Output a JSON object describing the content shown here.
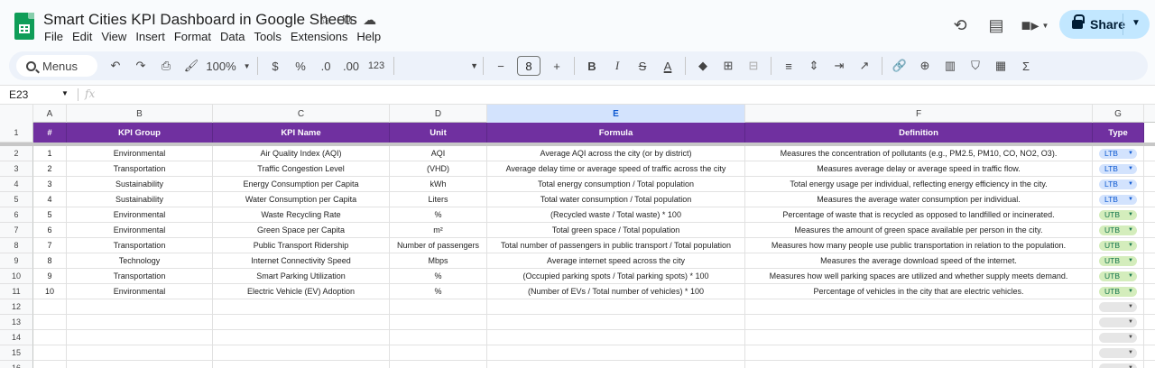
{
  "doc": {
    "title": "Smart Cities KPI Dashboard in Google Sheets"
  },
  "menu": [
    "File",
    "Edit",
    "View",
    "Insert",
    "Format",
    "Data",
    "Tools",
    "Extensions",
    "Help"
  ],
  "header": {
    "share_label": "Share"
  },
  "toolbar": {
    "menus_label": "Menus",
    "zoom": "100%",
    "currency": "$",
    "percent": "%",
    "dec_dec": ".0",
    "dec_inc": ".00",
    "number_format": "123",
    "font_size": "8"
  },
  "formula_bar": {
    "name_box": "E23",
    "fx": "fx"
  },
  "columns": [
    "A",
    "B",
    "C",
    "D",
    "E",
    "F",
    "G"
  ],
  "header_row": {
    "row_num": "1",
    "cells": [
      "#",
      "KPI Group",
      "KPI Name",
      "Unit",
      "Formula",
      "Definition",
      "Type"
    ]
  },
  "rows": [
    {
      "row_num": "2",
      "cells": [
        "1",
        "Environmental",
        "Air Quality Index (AQI)",
        "AQI",
        "Average AQI across the city (or by district)",
        "Measures the concentration of pollutants (e.g., PM2.5, PM10, CO, NO2, O3)."
      ],
      "type": "LTB"
    },
    {
      "row_num": "3",
      "cells": [
        "2",
        "Transportation",
        "Traffic Congestion Level",
        "(VHD)",
        "Average delay time or average speed of traffic across the city",
        "Measures average delay or average speed in traffic flow."
      ],
      "type": "LTB"
    },
    {
      "row_num": "4",
      "cells": [
        "3",
        "Sustainability",
        "Energy Consumption per Capita",
        "kWh",
        "Total energy consumption / Total population",
        "Total energy usage per individual, reflecting energy efficiency in the city."
      ],
      "type": "LTB"
    },
    {
      "row_num": "5",
      "cells": [
        "4",
        "Sustainability",
        "Water Consumption per Capita",
        "Liters",
        "Total water consumption / Total population",
        "Measures the average water consumption per individual."
      ],
      "type": "LTB"
    },
    {
      "row_num": "6",
      "cells": [
        "5",
        "Environmental",
        "Waste Recycling Rate",
        "%",
        "(Recycled waste / Total waste) * 100",
        "Percentage of waste that is recycled as opposed to landfilled or incinerated."
      ],
      "type": "UTB"
    },
    {
      "row_num": "7",
      "cells": [
        "6",
        "Environmental",
        "Green Space per Capita",
        "m²",
        "Total green space / Total population",
        "Measures the amount of green space available per person in the city."
      ],
      "type": "UTB"
    },
    {
      "row_num": "8",
      "cells": [
        "7",
        "Transportation",
        "Public Transport Ridership",
        "Number of passengers",
        "Total number of passengers in public transport / Total population",
        "Measures how many people use public transportation in relation to the population."
      ],
      "type": "UTB"
    },
    {
      "row_num": "9",
      "cells": [
        "8",
        "Technology",
        "Internet Connectivity Speed",
        "Mbps",
        "Average internet speed across the city",
        "Measures the average download speed of the internet."
      ],
      "type": "UTB"
    },
    {
      "row_num": "10",
      "cells": [
        "9",
        "Transportation",
        "Smart Parking Utilization",
        "%",
        "(Occupied parking spots / Total parking spots) * 100",
        "Measures how well parking spaces are utilized and whether supply meets demand."
      ],
      "type": "UTB"
    },
    {
      "row_num": "11",
      "cells": [
        "10",
        "Environmental",
        "Electric Vehicle (EV) Adoption",
        "%",
        "(Number of EVs / Total number of vehicles) * 100",
        "Percentage of vehicles in the city that are electric vehicles."
      ],
      "type": "UTB"
    },
    {
      "row_num": "12",
      "cells": [
        "",
        "",
        "",
        "",
        "",
        ""
      ],
      "type": ""
    },
    {
      "row_num": "13",
      "cells": [
        "",
        "",
        "",
        "",
        "",
        ""
      ],
      "type": ""
    },
    {
      "row_num": "14",
      "cells": [
        "",
        "",
        "",
        "",
        "",
        ""
      ],
      "type": ""
    },
    {
      "row_num": "15",
      "cells": [
        "",
        "",
        "",
        "",
        "",
        ""
      ],
      "type": ""
    },
    {
      "row_num": "16",
      "cells": [
        "",
        "",
        "",
        "",
        "",
        ""
      ],
      "type": ""
    }
  ],
  "colors": {
    "header_purple": "#7030a0",
    "ltb_chip": "#d3e3fd",
    "utb_chip": "#d4edbc",
    "share_bg": "#c2e7ff",
    "sheets_green": "#0f9d58"
  }
}
